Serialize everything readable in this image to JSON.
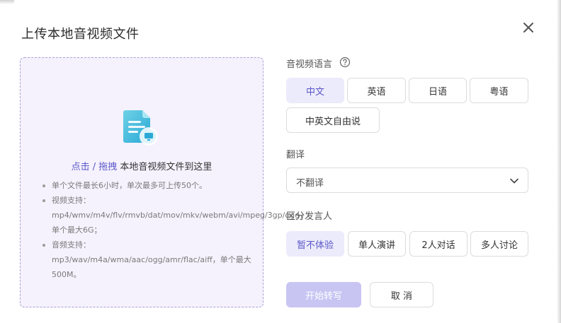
{
  "dialog": {
    "title": "上传本地音视频文件"
  },
  "upload": {
    "link_text": "点击 / 拖拽",
    "drop_text": " 本地音视频文件到这里",
    "notes": [
      "单个文件最长6小时，单次最多可上传50个。",
      "视频支持：mp4/wmv/m4v/flv/rmvb/dat/mov/mkv/webm/avi/mpeg/3gp/ogg，单个最大6G；",
      "音频支持：mp3/wav/m4a/wma/aac/ogg/amr/flac/aiff，单个最大500M。"
    ]
  },
  "language": {
    "label": "音视频语言",
    "options": [
      "中文",
      "英语",
      "日语",
      "粤语",
      "中英文自由说"
    ],
    "selected": "中文"
  },
  "translate": {
    "label": "翻译",
    "value": "不翻译"
  },
  "speaker": {
    "label": "区分发言人",
    "options": [
      "暂不体验",
      "单人演讲",
      "2人对话",
      "多人讨论"
    ],
    "selected": "暂不体验"
  },
  "actions": {
    "start_label": "开始转写",
    "cancel_label": "取 消"
  },
  "colors": {
    "accent": "#5b57c9",
    "selected_bg": "#ecebfb",
    "upload_bg": "#f5f2fd",
    "primary_disabled": "#c8c5f3"
  },
  "icons": {
    "close": "close-icon",
    "help": "question-circle-icon",
    "file": "file-upload-icon",
    "chevron": "chevron-down-icon"
  }
}
